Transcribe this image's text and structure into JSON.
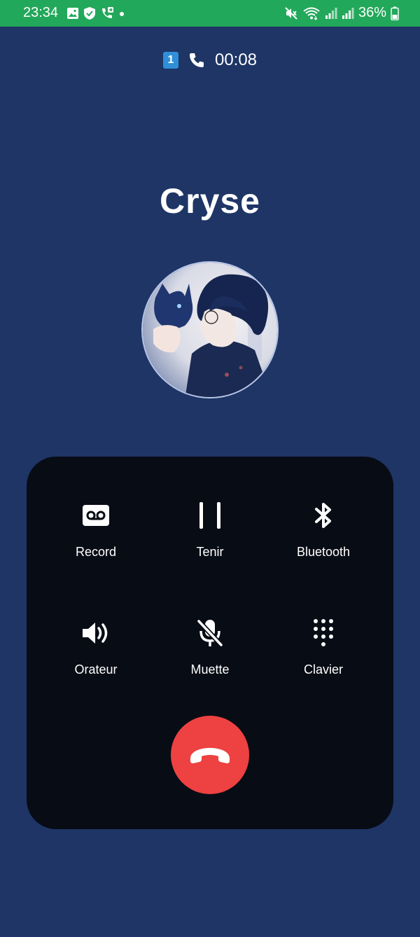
{
  "status_bar": {
    "time": "23:34",
    "battery": "36%",
    "icons_left": [
      "gallery-icon",
      "shield-icon",
      "call-forward-icon",
      "dot-icon"
    ],
    "icons_right": [
      "mute-vibrate-icon",
      "wifi-icon",
      "signal-icon",
      "signal-icon",
      "battery-icon"
    ]
  },
  "call": {
    "sim": "1",
    "duration": "00:08",
    "contact_name": "Cryse"
  },
  "controls": [
    {
      "label": "Record",
      "icon": "voicemail-icon"
    },
    {
      "label": "Tenir",
      "icon": "pause-icon"
    },
    {
      "label": "Bluetooth",
      "icon": "bluetooth-icon"
    },
    {
      "label": "Orateur",
      "icon": "speaker-icon"
    },
    {
      "label": "Muette",
      "icon": "mic-off-icon"
    },
    {
      "label": "Clavier",
      "icon": "dialpad-icon"
    }
  ],
  "colors": {
    "background": "#1e3566",
    "status_bar": "#22a85a",
    "panel": "#080c15",
    "end_call": "#ee4141"
  }
}
